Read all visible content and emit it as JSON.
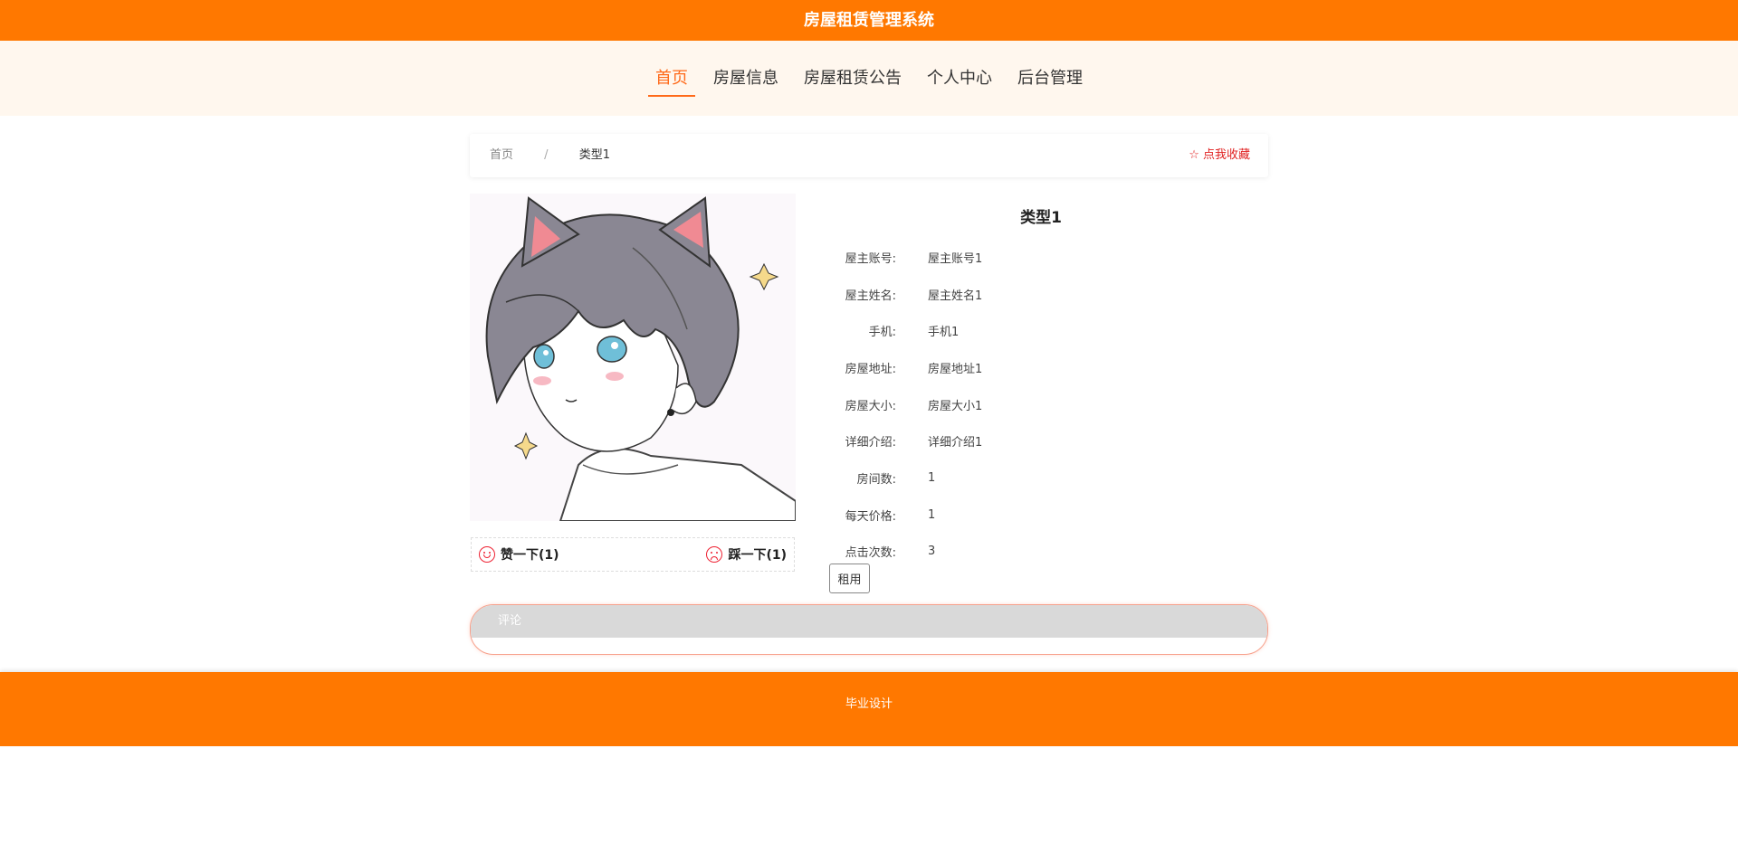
{
  "app": {
    "title": "房屋租赁管理系统"
  },
  "nav": {
    "items": [
      {
        "label": "首页",
        "active": true
      },
      {
        "label": "房屋信息"
      },
      {
        "label": "房屋租赁公告"
      },
      {
        "label": "个人中心"
      },
      {
        "label": "后台管理"
      }
    ]
  },
  "breadcrumb": {
    "home": "首页",
    "separator": "/",
    "current": "类型1"
  },
  "favorite": {
    "label": "点我收藏",
    "icon": "star-outline-icon",
    "color": "#e02020"
  },
  "detail": {
    "title": "类型1",
    "fields": [
      {
        "label": "屋主账号:",
        "value": "屋主账号1"
      },
      {
        "label": "屋主姓名:",
        "value": "屋主姓名1"
      },
      {
        "label": "手机:",
        "value": "手机1"
      },
      {
        "label": "房屋地址:",
        "value": "房屋地址1"
      },
      {
        "label": "房屋大小:",
        "value": "房屋大小1"
      },
      {
        "label": "详细介绍:",
        "value": "详细介绍1"
      },
      {
        "label": "房间数:",
        "value": "1"
      },
      {
        "label": "每天价格:",
        "value": "1"
      },
      {
        "label": "点击次数:",
        "value": "3"
      }
    ],
    "rent_button": "租用"
  },
  "votes": {
    "like": {
      "label": "赞一下(1)",
      "icon": "smile-icon"
    },
    "dislike": {
      "label": "踩一下(1)",
      "icon": "frown-icon"
    }
  },
  "comment": {
    "header": "评论"
  },
  "footer": {
    "text": "毕业设计"
  },
  "colors": {
    "primary": "#ff7800",
    "accent": "#ff6a1a",
    "nav_bg": "#fff7ee"
  }
}
